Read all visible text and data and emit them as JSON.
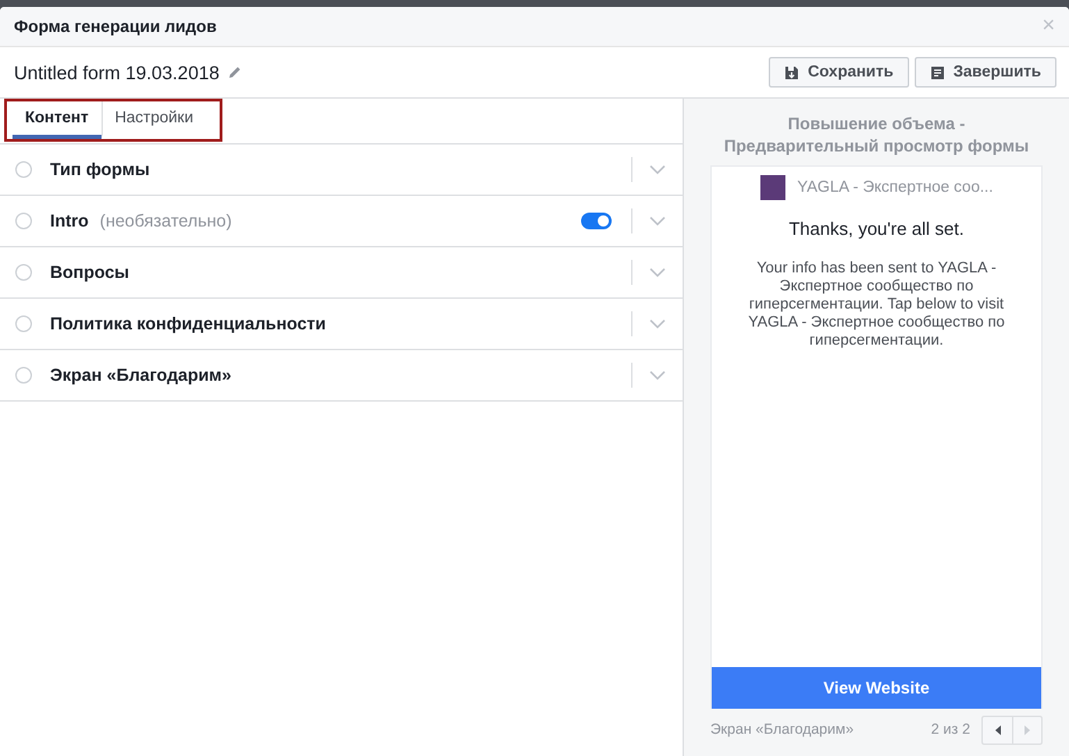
{
  "dialog": {
    "title": "Форма генерации лидов",
    "close": "×"
  },
  "form_title": "Untitled form 19.03.2018",
  "buttons": [
    {
      "kind": "save",
      "label": "Сохранить"
    },
    {
      "kind": "finish",
      "label": "Завершить"
    }
  ],
  "tabs": [
    {
      "label": "Контент",
      "selected": true
    },
    {
      "label": "Настройки",
      "selected": false
    }
  ],
  "sections": [
    {
      "title": "Тип формы",
      "checked": false
    },
    {
      "title": "Intro",
      "note": "(необязательно)",
      "checked": false,
      "toggle_on": true
    },
    {
      "title": "Вопросы",
      "checked": false
    },
    {
      "title": "Политика конфиденциальности",
      "checked": false
    },
    {
      "title": "Экран «Благодарим»",
      "checked": false
    }
  ],
  "preview": {
    "heading": "Повышение объема - Предварительный просмотр формы",
    "page_name": "YAGLA - Экспертное соо...",
    "thanks": "Thanks, you're all set.",
    "message": "Your info has been sent to YAGLA - Экспертное сообщество по гиперсегментации. Tap below to visit YAGLA - Экспертное сообщество по гиперсегментации.",
    "cta": "View Website",
    "screen_label": "Экран «Благодарим»",
    "pager": "2 из 2",
    "pager_buttons": [
      {
        "kind": "prev",
        "disabled": false
      },
      {
        "kind": "next",
        "disabled": true
      }
    ]
  }
}
